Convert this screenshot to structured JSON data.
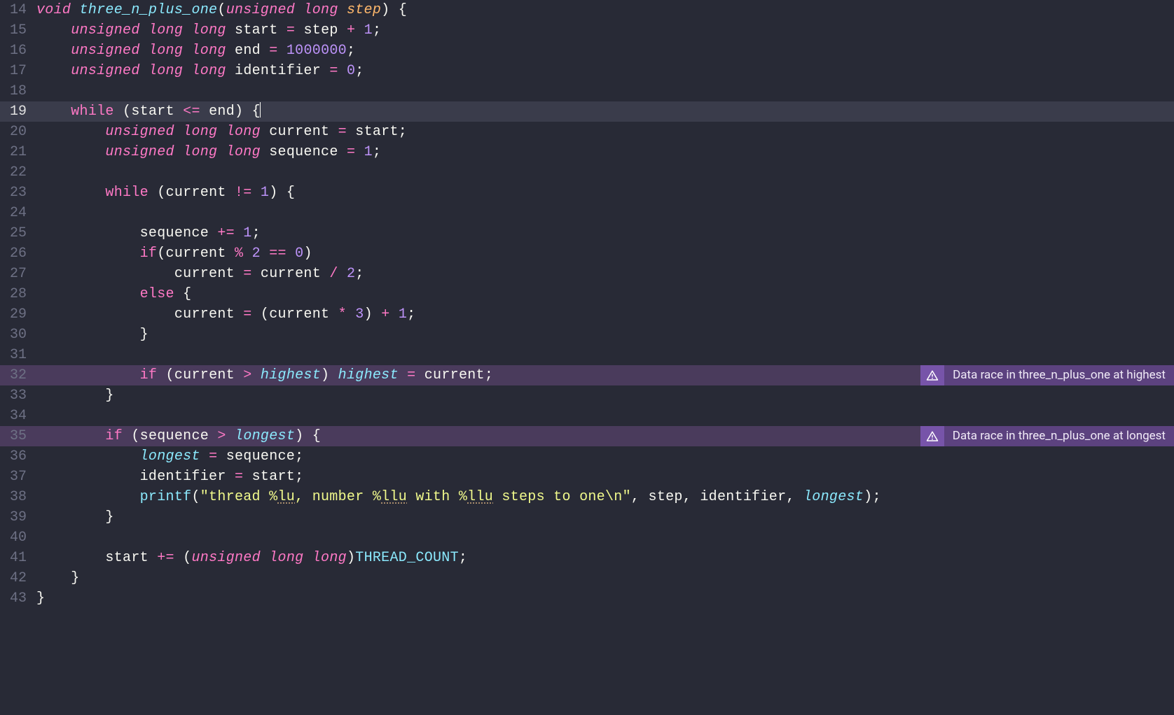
{
  "gutter": {
    "l14": "14",
    "l15": "15",
    "l16": "16",
    "l17": "17",
    "l18": "18",
    "l19": "19",
    "l20": "20",
    "l21": "21",
    "l22": "22",
    "l23": "23",
    "l24": "24",
    "l25": "25",
    "l26": "26",
    "l27": "27",
    "l28": "28",
    "l29": "29",
    "l30": "30",
    "l31": "31",
    "l32": "32",
    "l33": "33",
    "l34": "34",
    "l35": "35",
    "l36": "36",
    "l37": "37",
    "l38": "38",
    "l39": "39",
    "l40": "40",
    "l41": "41",
    "l42": "42",
    "l43": "43"
  },
  "t": {
    "kw_void": "void",
    "fn_name": "three_n_plus_one",
    "kw_unsigned": "unsigned",
    "kw_long": "long",
    "p_step": "step",
    "v_start": "start",
    "v_end": "end",
    "v_identifier": "identifier",
    "v_current": "current",
    "v_sequence": "sequence",
    "g_highest": "highest",
    "g_longest": "longest",
    "kw_while": "while",
    "kw_if": "if",
    "kw_else": "else",
    "op_eq": "=",
    "op_plus": "+",
    "op_minus": "-",
    "op_le": "<=",
    "op_gt": ">",
    "op_ne": "!=",
    "op_pe": "+=",
    "op_mod": "%",
    "op_ee": "==",
    "op_div": "/",
    "op_mul": "*",
    "n_1": "1",
    "n_0": "0",
    "n_1M": "1000000",
    "n_2": "2",
    "n_3": "3",
    "fn_printf": "printf",
    "str_a": "\"thread ",
    "pct": "%",
    "spec_lu": "lu",
    "str_b": ", number ",
    "spec_llu": "llu",
    "str_c": " with ",
    "str_d": " steps to one",
    "esc_n": "\\n",
    "str_e": "\"",
    "macro": "THREAD_COUNT",
    "lp": "(",
    "rp": ")",
    "lb": "{",
    "rb": "}",
    "sc": ";",
    "comma": ", "
  },
  "issues": {
    "i32": "Data race in three_n_plus_one at highest",
    "i35": "Data race in three_n_plus_one at longest"
  },
  "colors": {
    "bg": "#282a36",
    "current_line": "#3a3c4b",
    "issue_line": "#4a3b5c",
    "issue_badge": "#7754a9",
    "issue_text_bg": "#5c427f",
    "keyword": "#ff79c6",
    "function": "#8be9fd",
    "number": "#bd93f9",
    "string": "#f1fa8c",
    "param": "#ffb86c",
    "text": "#f8f8f2",
    "gutter": "#6d7084"
  }
}
